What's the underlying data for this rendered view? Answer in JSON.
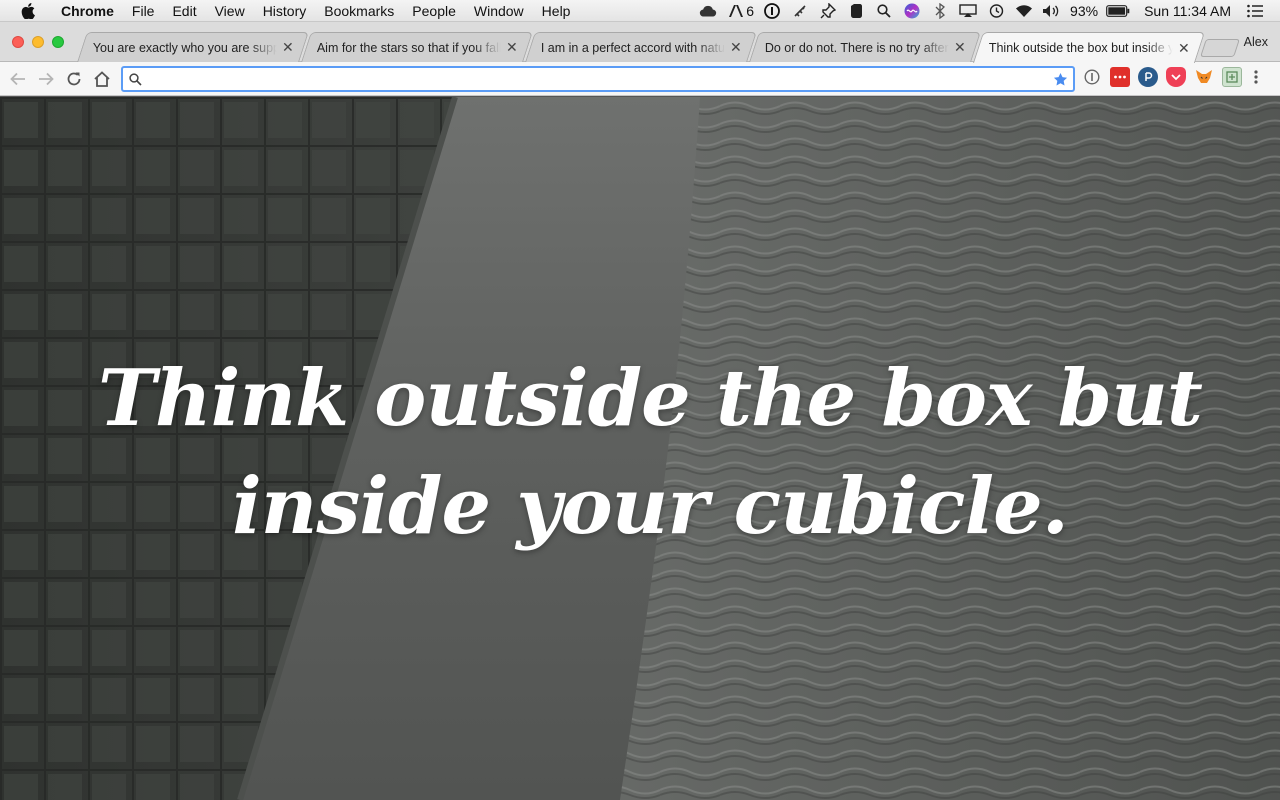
{
  "menubar": {
    "app_name": "Chrome",
    "items": [
      "File",
      "Edit",
      "View",
      "History",
      "Bookmarks",
      "People",
      "Window",
      "Help"
    ],
    "status": {
      "adobe_count": "6",
      "battery": "93%",
      "clock": "Sun 11:34 AM"
    }
  },
  "tabs": [
    {
      "title": "You are exactly who you are supposed to be",
      "active": false
    },
    {
      "title": "Aim for the stars so that if you fall",
      "active": false
    },
    {
      "title": "I am in a perfect accord with nature",
      "active": false
    },
    {
      "title": "Do or do not. There is no try after",
      "active": false
    },
    {
      "title": "Think outside the box but inside your cubicle.",
      "active": true
    }
  ],
  "profile_name": "Alex",
  "omnibox": {
    "value": "",
    "placeholder": ""
  },
  "page": {
    "quote": "Think outside the box but inside your cubicle."
  },
  "colors": {
    "omnibox_focus": "#5b9cf6",
    "bookmark_star": "#4a8cf0",
    "quote_text": "#ffffff"
  }
}
